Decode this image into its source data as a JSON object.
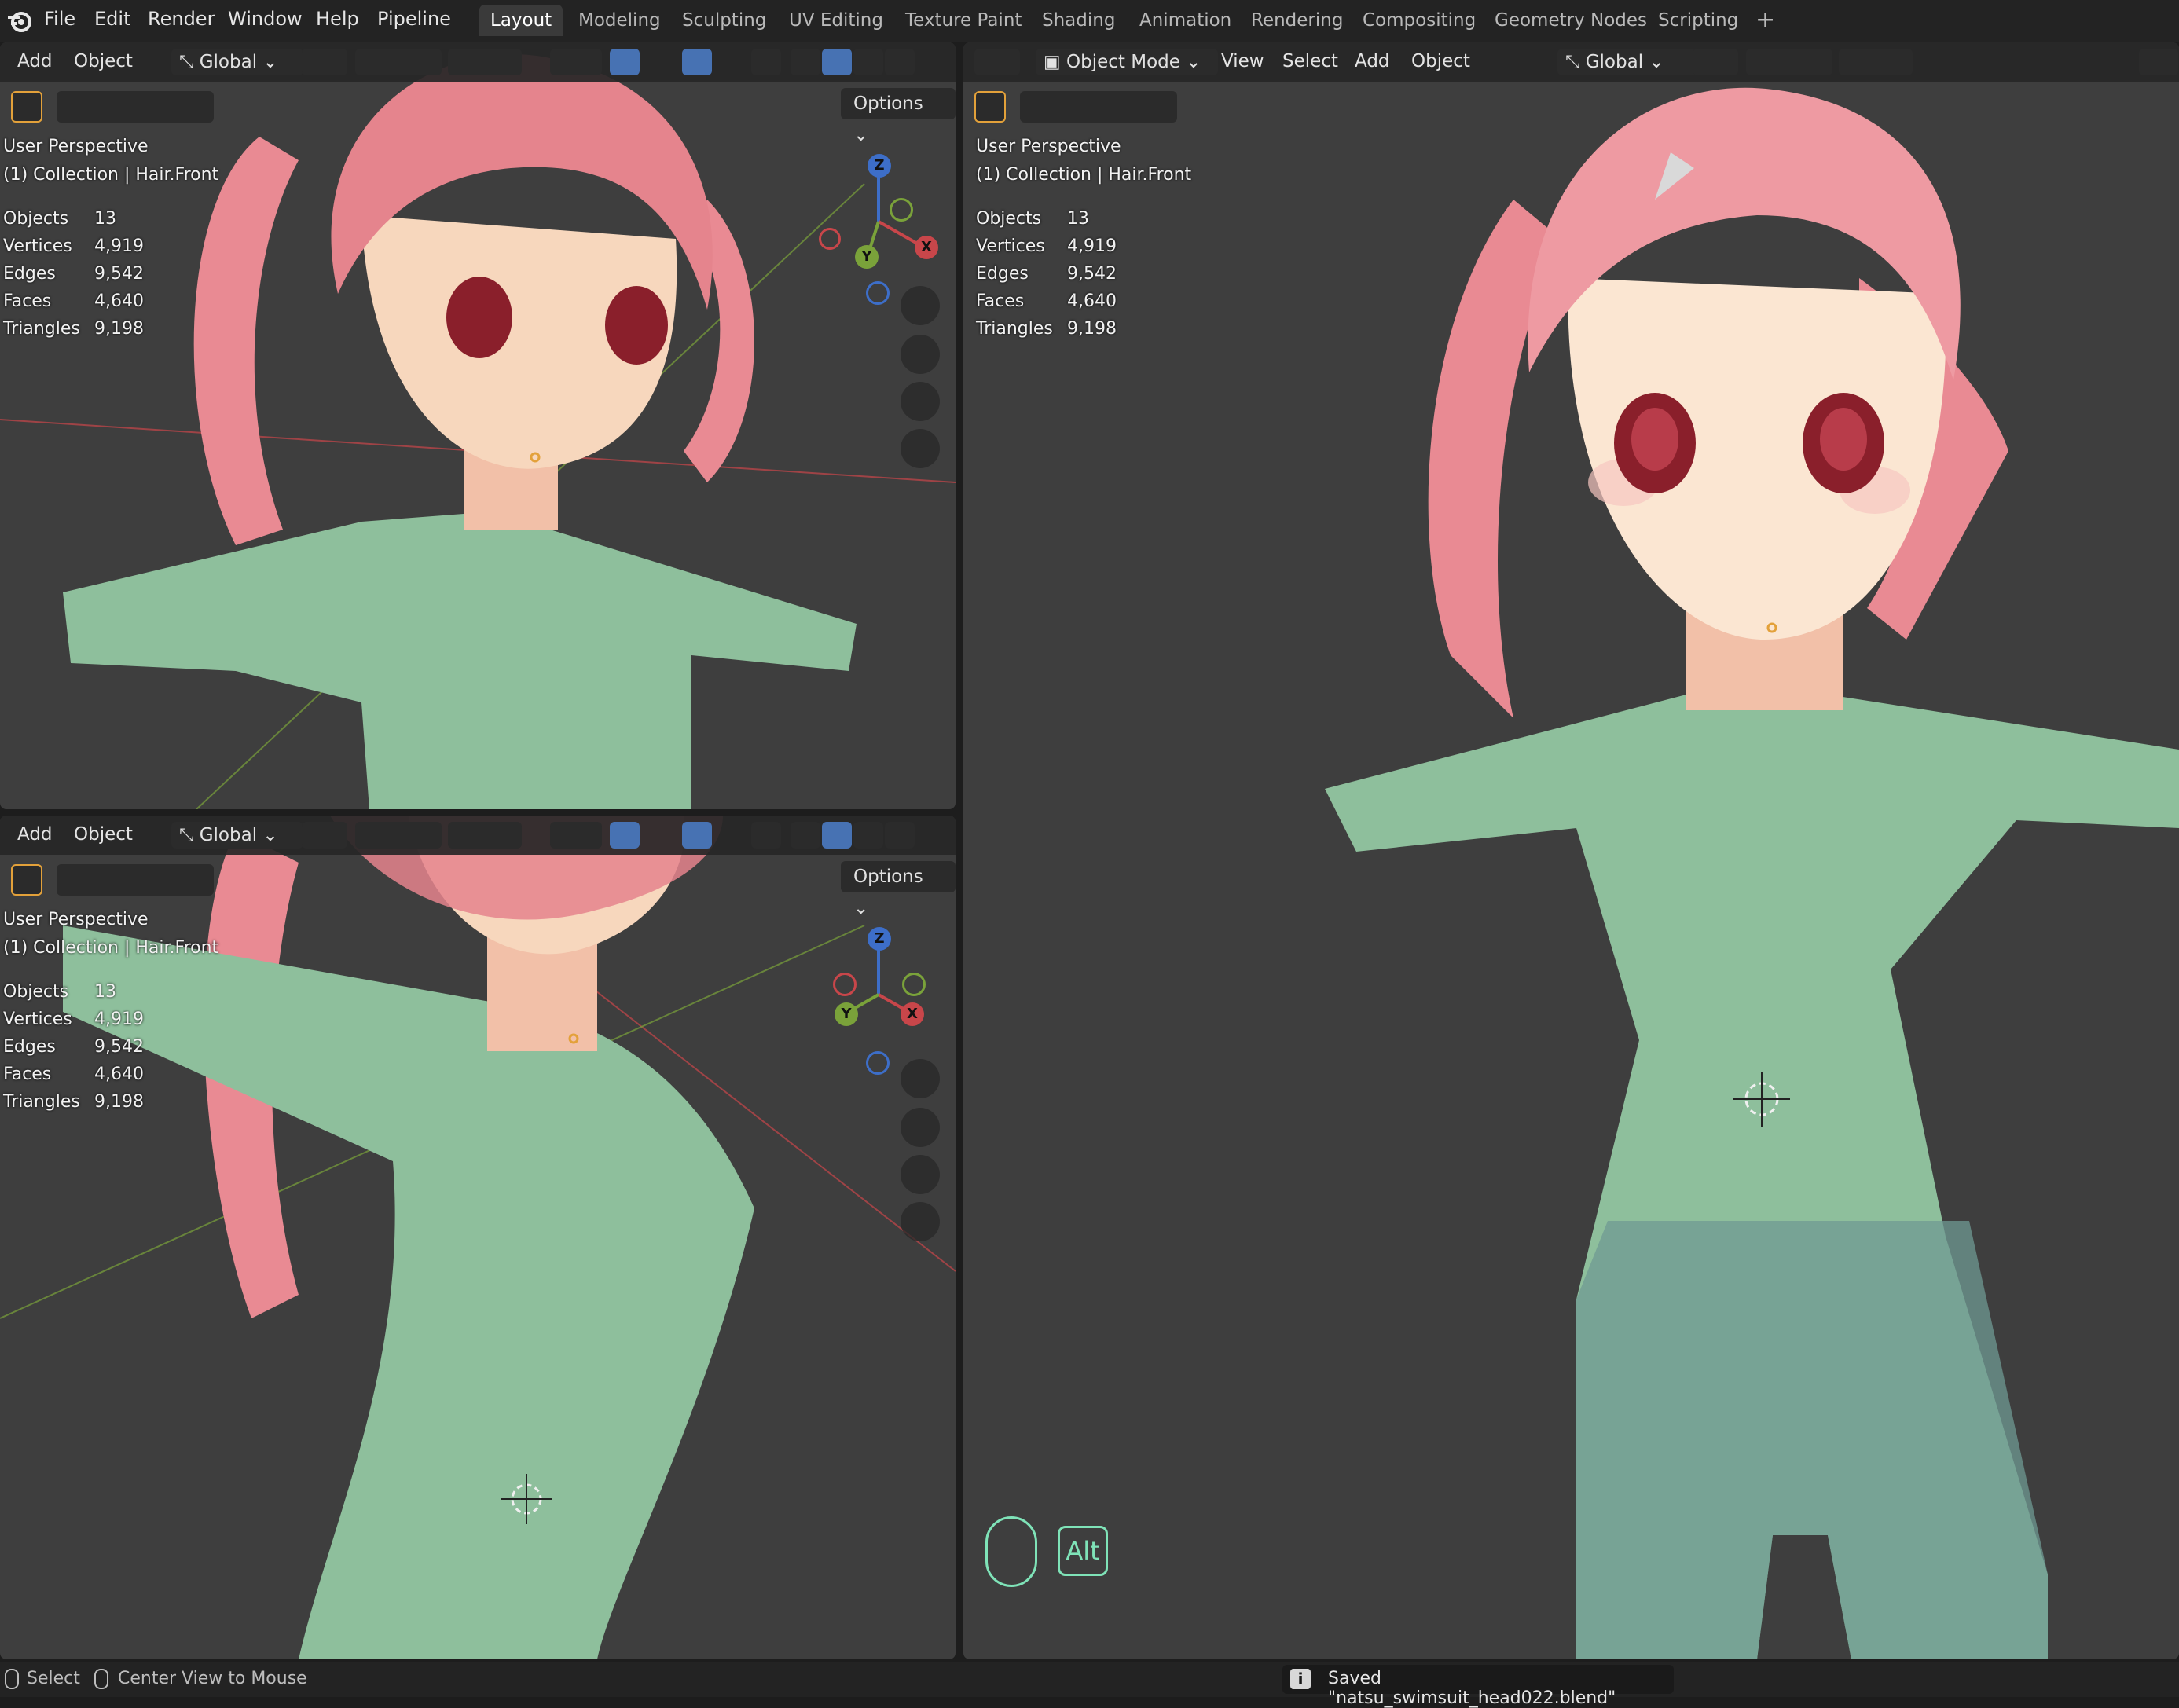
{
  "menubar": {
    "items": [
      "File",
      "Edit",
      "Render",
      "Window",
      "Help",
      "Pipeline"
    ],
    "workspaces": [
      "Layout",
      "Modeling",
      "Sculpting",
      "UV Editing",
      "Texture Paint",
      "Shading",
      "Animation",
      "Rendering",
      "Compositing",
      "Geometry Nodes",
      "Scripting"
    ],
    "active_workspace": "Layout",
    "add_workspace": "+"
  },
  "viewport_left": {
    "menu": [
      "Add",
      "Object"
    ],
    "orientation": "Global",
    "options_label": "Options"
  },
  "viewport_right": {
    "mode": "Object Mode",
    "menu": [
      "View",
      "Select",
      "Add",
      "Object"
    ],
    "orientation": "Global"
  },
  "overlay": {
    "perspective": "User Perspective",
    "collection": "(1) Collection | Hair.Front",
    "stats": [
      {
        "label": "Objects",
        "value": "13"
      },
      {
        "label": "Vertices",
        "value": "4,919"
      },
      {
        "label": "Edges",
        "value": "9,542"
      },
      {
        "label": "Faces",
        "value": "4,640"
      },
      {
        "label": "Triangles",
        "value": "9,198"
      }
    ]
  },
  "gizmo": {
    "x": "X",
    "y": "Y",
    "z": "Z"
  },
  "key_overlay": {
    "key": "Alt"
  },
  "statusbar": {
    "select": "Select",
    "center_view": "Center View to Mouse",
    "saved": "Saved \"natsu_swimsuit_head022.blend\""
  },
  "colors": {
    "viewport_bg": "#3e3e3e",
    "accent_blue": "#4772b3",
    "hair_pink": "#e98a93",
    "suit_green": "#8ebf9c",
    "axis_red": "#c8464a",
    "axis_green": "#7aa23a",
    "axis_blue": "#3d6ec8",
    "origin_orange": "#e3a13a"
  }
}
